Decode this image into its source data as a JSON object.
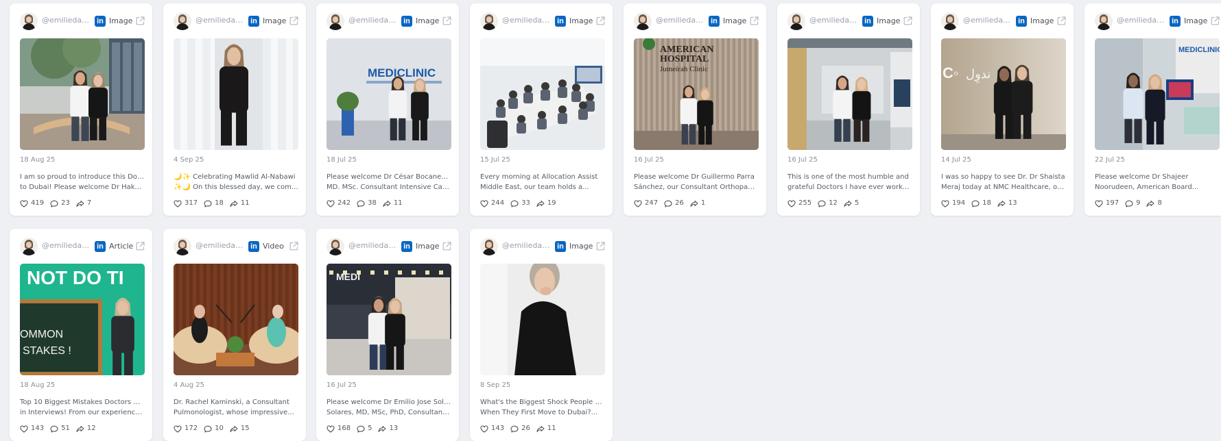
{
  "posts": [
    {
      "handle": "@emiliedav...",
      "type": "Image",
      "date": "18 Aug 25",
      "caption": [
        "I am so proud to introduce this Doctor",
        "to Dubai! Please welcome Dr Hakam..."
      ],
      "likes": "419",
      "comments": "23",
      "shares": "7",
      "scene": "lobby"
    },
    {
      "handle": "@emiliedav...",
      "type": "Image",
      "date": "4 Sep 25",
      "caption": [
        "🌙✨ Celebrating Mawlid Al-Nabawi",
        "✨🌙 On this blessed day, we come..."
      ],
      "likes": "317",
      "comments": "18",
      "shares": "11",
      "scene": "portrait-curtain"
    },
    {
      "handle": "@emiliedav...",
      "type": "Image",
      "date": "18 Jul 25",
      "caption": [
        "Please welcome Dr César Bocanegra.",
        "MD. MSc. Consultant Intensive Care..."
      ],
      "likes": "242",
      "comments": "38",
      "shares": "11",
      "scene": "mediclinic-wall"
    },
    {
      "handle": "@emiliedav...",
      "type": "Image",
      "date": "15 Jul 25",
      "caption": [
        "Every morning at Allocation Assist",
        "Middle East, our team holds a..."
      ],
      "likes": "244",
      "comments": "33",
      "shares": "19",
      "scene": "meeting"
    },
    {
      "handle": "@emiliedav...",
      "type": "Image",
      "date": "16 Jul 25",
      "caption": [
        "Please welcome Dr Guillermo Parra",
        "Sánchez, our Consultant Orthopaedic..."
      ],
      "likes": "247",
      "comments": "26",
      "shares": "1",
      "scene": "american-hospital"
    },
    {
      "handle": "@emiliedav...",
      "type": "Image",
      "date": "16 Jul 25",
      "caption": [
        "This is one of the most humble and",
        "grateful Doctors I have ever worked..."
      ],
      "likes": "255",
      "comments": "12",
      "shares": "5",
      "scene": "clinic-hall"
    },
    {
      "handle": "@emiliedav...",
      "type": "Image",
      "date": "14 Jul 25",
      "caption": [
        "I was so happy to see Dr. Dr Shaista",
        "Meraj today at NMC Healthcare, our U..."
      ],
      "likes": "194",
      "comments": "18",
      "shares": "13",
      "scene": "nmc-wall"
    },
    {
      "handle": "@emiliedav...",
      "type": "Image",
      "date": "22 Jul 25",
      "caption": [
        "Please welcome Dr Shajeer",
        "Noorudeen, American Board..."
      ],
      "likes": "197",
      "comments": "9",
      "shares": "8",
      "scene": "mediclinic-atrium"
    },
    {
      "handle": "@emiliedavi...",
      "type": "Article",
      "date": "18 Aug 25",
      "caption": [
        "Top 10 Biggest Mistakes Doctors make",
        "in Interviews! From our experience of..."
      ],
      "likes": "143",
      "comments": "51",
      "shares": "12",
      "scene": "article",
      "thumb_text": {
        "line1": "NOT DO TI",
        "board": [
          "OMMON",
          "STAKES !"
        ]
      }
    },
    {
      "handle": "@emiliedavi...",
      "type": "Video",
      "date": "4 Aug 25",
      "caption": [
        "Dr. Rachel Kaminski, a Consultant",
        "Pulmonologist, whose impressive..."
      ],
      "likes": "172",
      "comments": "10",
      "shares": "15",
      "scene": "podcast"
    },
    {
      "handle": "@emiliedav...",
      "type": "Image",
      "date": "16 Jul 25",
      "caption": [
        "Please welcome Dr Emilio Jose Solano",
        "Solares, MD, MSc, PhD, Consultant..."
      ],
      "likes": "168",
      "comments": "5",
      "shares": "13",
      "scene": "corridor"
    },
    {
      "handle": "@emiliedav...",
      "type": "Image",
      "date": "8 Sep 25",
      "caption": [
        "What's the Biggest Shock People Find",
        "When They First Move to Dubai?..."
      ],
      "likes": "143",
      "comments": "26",
      "shares": "11",
      "scene": "portrait-closeup"
    }
  ],
  "colors": {
    "linkedin": "#0a66c2",
    "card_bg": "#ffffff",
    "page_bg": "#eef0f4",
    "meta_text": "#8a8f98"
  },
  "icons": {
    "network": "linkedin-icon",
    "open": "external-link-icon",
    "likes": "heart-icon",
    "comments": "comment-icon",
    "shares": "share-icon"
  }
}
